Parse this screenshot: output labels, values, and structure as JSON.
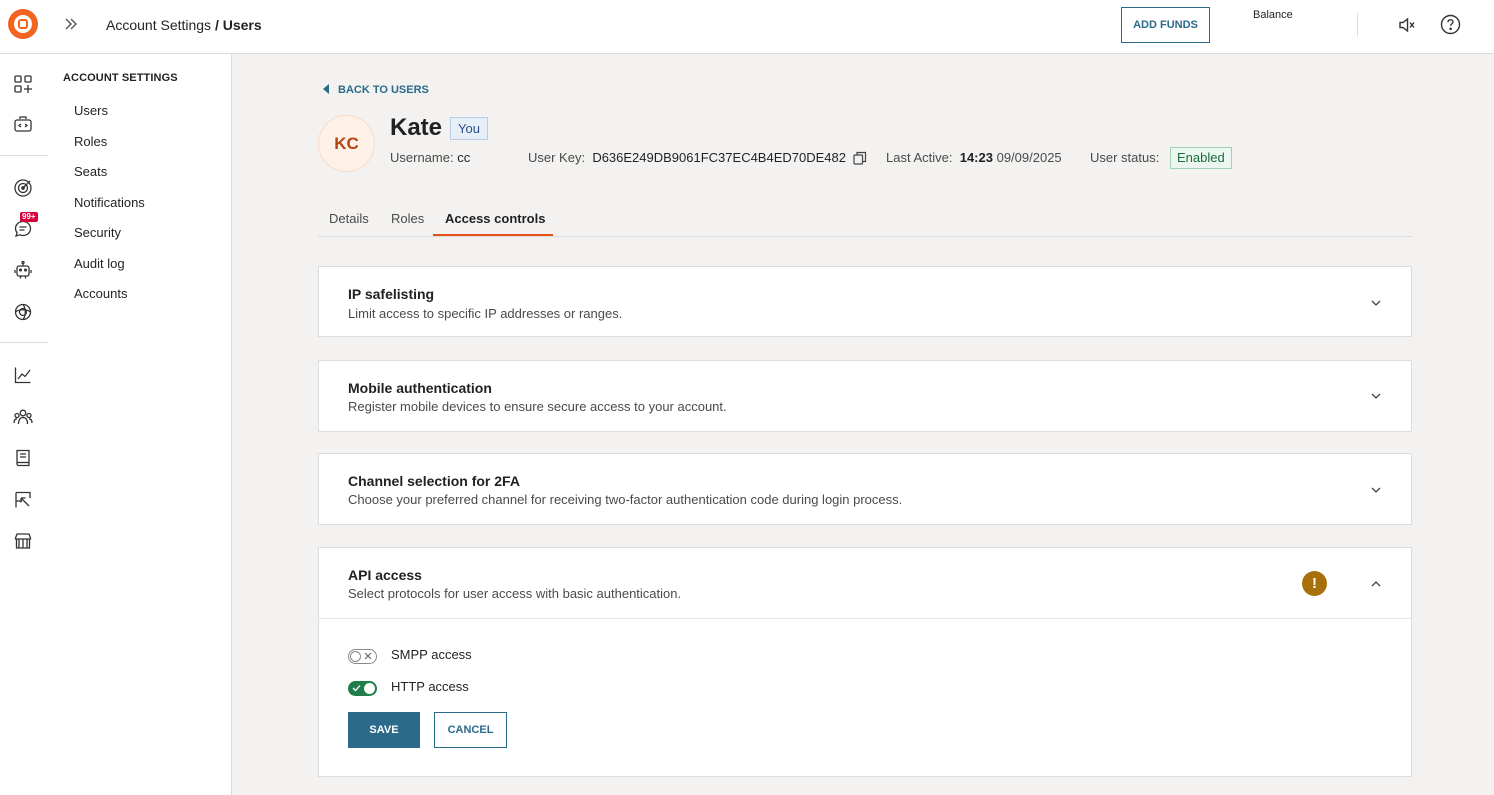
{
  "header": {
    "breadcrumb_parent": "Account Settings",
    "breadcrumb_sep": " / ",
    "breadcrumb_current": "Users",
    "add_funds_label": "ADD FUNDS",
    "balance_label": "Balance"
  },
  "rail": {
    "notification_badge": "99+",
    "icons": [
      "apps-icon",
      "code-icon",
      "target-icon",
      "chat-icon",
      "bot-icon",
      "ai-icon",
      "analytics-icon",
      "people-icon",
      "book-icon",
      "campaign-icon",
      "store-icon"
    ]
  },
  "sidebar": {
    "heading": "ACCOUNT SETTINGS",
    "items": [
      {
        "label": "Users"
      },
      {
        "label": "Roles"
      },
      {
        "label": "Seats"
      },
      {
        "label": "Notifications"
      },
      {
        "label": "Security"
      },
      {
        "label": "Audit log"
      },
      {
        "label": "Accounts"
      }
    ]
  },
  "profile": {
    "back_label": "BACK TO USERS",
    "initials": "KC",
    "name": "Kate",
    "you_badge": "You",
    "username_label": "Username:",
    "username": "cc",
    "user_key_label": "User Key:",
    "user_key": "D636E249DB9061FC37EC4B4ED70DE482",
    "last_active_label": "Last Active:",
    "last_active_time": "14:23",
    "last_active_date": "09/09/2025",
    "status_label": "User status:",
    "status": "Enabled"
  },
  "tabs": [
    {
      "label": "Details"
    },
    {
      "label": "Roles"
    },
    {
      "label": "Access controls",
      "active": true
    }
  ],
  "cards": [
    {
      "title": "IP safelisting",
      "description": "Limit access to specific IP addresses or ranges.",
      "expanded": false
    },
    {
      "title": "Mobile authentication",
      "description": "Register mobile devices to ensure secure access to your account.",
      "expanded": false
    },
    {
      "title": "Channel selection for 2FA",
      "description": "Choose your preferred channel for receiving two-factor authentication code during login process.",
      "expanded": false
    },
    {
      "title": "API access",
      "description": "Select protocols for user access with basic authentication.",
      "expanded": true,
      "warning": "!"
    }
  ],
  "api_access": {
    "toggles": [
      {
        "label": "SMPP access",
        "enabled": false
      },
      {
        "label": "HTTP access",
        "enabled": true
      }
    ],
    "save_label": "SAVE",
    "cancel_label": "CANCEL"
  },
  "colors": {
    "accent": "#e5531a",
    "primary": "#2b6a8a",
    "success": "#1e7d4a",
    "warning": "#a8700b",
    "badge": "#d6003c"
  }
}
